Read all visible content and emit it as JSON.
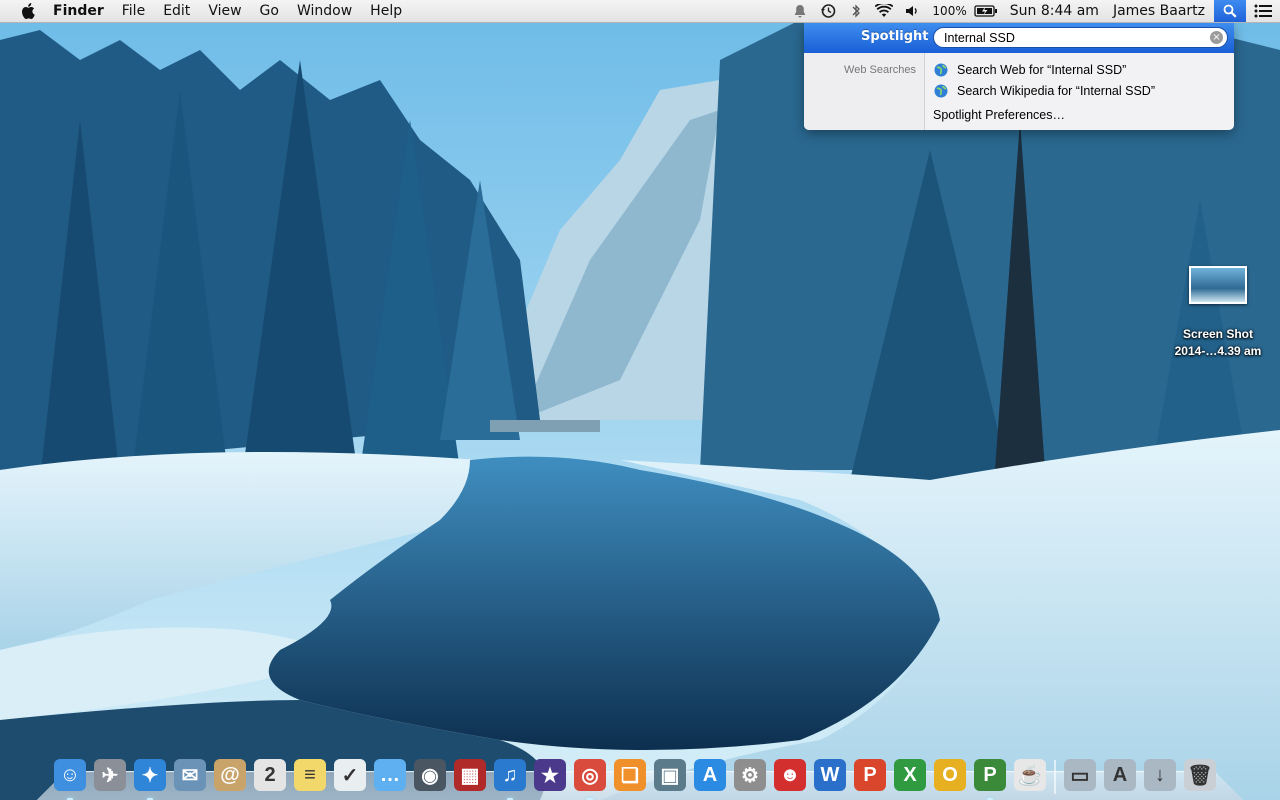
{
  "menubar": {
    "apple_icon": "apple-logo-icon",
    "app_name": "Finder",
    "menus": [
      "File",
      "Edit",
      "View",
      "Go",
      "Window",
      "Help"
    ],
    "status": {
      "battery_percent": "100%",
      "clock": "Sun 8:44 am",
      "user": "James Baartz"
    }
  },
  "spotlight": {
    "title": "Spotlight",
    "query": "Internal SSD",
    "clear_glyph": "×",
    "category": "Web Searches",
    "results": [
      "Search Web for “Internal SSD”",
      "Search Wikipedia for “Internal SSD”"
    ],
    "preferences": "Spotlight Preferences…"
  },
  "desktop": {
    "file": {
      "name_line1": "Screen Shot",
      "name_line2": "2014-…4.39 am"
    }
  },
  "colors": {
    "spotlight_header": "#2a72e4",
    "menubar": "#ececec"
  },
  "dock": {
    "apps": [
      {
        "name": "finder",
        "glyph": "☺",
        "color": "#3f8fe0",
        "running": true
      },
      {
        "name": "launchpad",
        "glyph": "✈",
        "color": "#8a8f98",
        "running": false
      },
      {
        "name": "safari",
        "glyph": "✦",
        "color": "#2f86d9",
        "running": true
      },
      {
        "name": "mail",
        "glyph": "✉",
        "color": "#6b93b8",
        "running": false
      },
      {
        "name": "contacts",
        "glyph": "@",
        "color": "#c9a46a",
        "running": false
      },
      {
        "name": "calendar",
        "glyph": "2",
        "color": "#e4e4e4",
        "running": false
      },
      {
        "name": "notes",
        "glyph": "≡",
        "color": "#f2d86a",
        "running": false
      },
      {
        "name": "reminders",
        "glyph": "✓",
        "color": "#e9eef0",
        "running": false
      },
      {
        "name": "messages",
        "glyph": "…",
        "color": "#5fb0f0",
        "running": false
      },
      {
        "name": "facetime",
        "glyph": "◉",
        "color": "#4a5763",
        "running": false
      },
      {
        "name": "photo-booth",
        "glyph": "▦",
        "color": "#b02a2a",
        "running": false
      },
      {
        "name": "itunes",
        "glyph": "♫",
        "color": "#2a7ad0",
        "running": true
      },
      {
        "name": "imovie",
        "glyph": "★",
        "color": "#4b3a8c",
        "running": false
      },
      {
        "name": "chrome",
        "glyph": "◎",
        "color": "#d94b3c",
        "running": true
      },
      {
        "name": "ibooks",
        "glyph": "❏",
        "color": "#f0902a",
        "running": false
      },
      {
        "name": "preview",
        "glyph": "▣",
        "color": "#5b7a8a",
        "running": false
      },
      {
        "name": "app-store",
        "glyph": "A",
        "color": "#2b8be2",
        "running": false
      },
      {
        "name": "system-preferences",
        "glyph": "⚙",
        "color": "#8e8e8e",
        "running": false
      },
      {
        "name": "game",
        "glyph": "☻",
        "color": "#d32f2f",
        "running": false
      },
      {
        "name": "word",
        "glyph": "W",
        "color": "#2a6fc9",
        "running": false
      },
      {
        "name": "powerpoint",
        "glyph": "P",
        "color": "#d9462b",
        "running": false
      },
      {
        "name": "excel",
        "glyph": "X",
        "color": "#2f9a3f",
        "running": false
      },
      {
        "name": "outlook",
        "glyph": "O",
        "color": "#e6b020",
        "running": false
      },
      {
        "name": "project",
        "glyph": "P",
        "color": "#3a8a3a",
        "running": true
      },
      {
        "name": "java",
        "glyph": "☕",
        "color": "#e7e7e7",
        "running": false
      }
    ],
    "stacks": [
      {
        "name": "documents-folder",
        "glyph": "▭",
        "color": "#aab8c4"
      },
      {
        "name": "applications-folder",
        "glyph": "A",
        "color": "#aab8c4"
      },
      {
        "name": "downloads-folder",
        "glyph": "↓",
        "color": "#aab8c4"
      },
      {
        "name": "trash",
        "glyph": "🗑",
        "color": "#c9cfd4"
      }
    ]
  }
}
